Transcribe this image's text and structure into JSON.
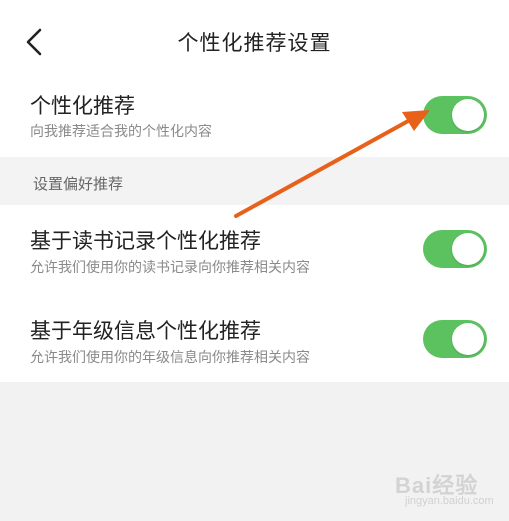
{
  "header": {
    "title": "个性化推荐设置",
    "back_icon": "chevron-left-icon"
  },
  "main_setting": {
    "title": "个性化推荐",
    "subtitle": "向我推荐适合我的个性化内容",
    "enabled": true
  },
  "section": {
    "label": "设置偏好推荐"
  },
  "preferences": [
    {
      "title": "基于读书记录个性化推荐",
      "subtitle": "允许我们使用你的读书记录向你推荐相关内容",
      "enabled": true
    },
    {
      "title": "基于年级信息个性化推荐",
      "subtitle": "允许我们使用你的年级信息向你推荐相关内容",
      "enabled": true
    }
  ],
  "watermark": {
    "text": "Bai经验",
    "sub": "jingyan.baidu.com"
  },
  "colors": {
    "toggle_on": "#5cc260",
    "annotation_arrow": "#e8611a",
    "background": "#f5f5f5"
  }
}
